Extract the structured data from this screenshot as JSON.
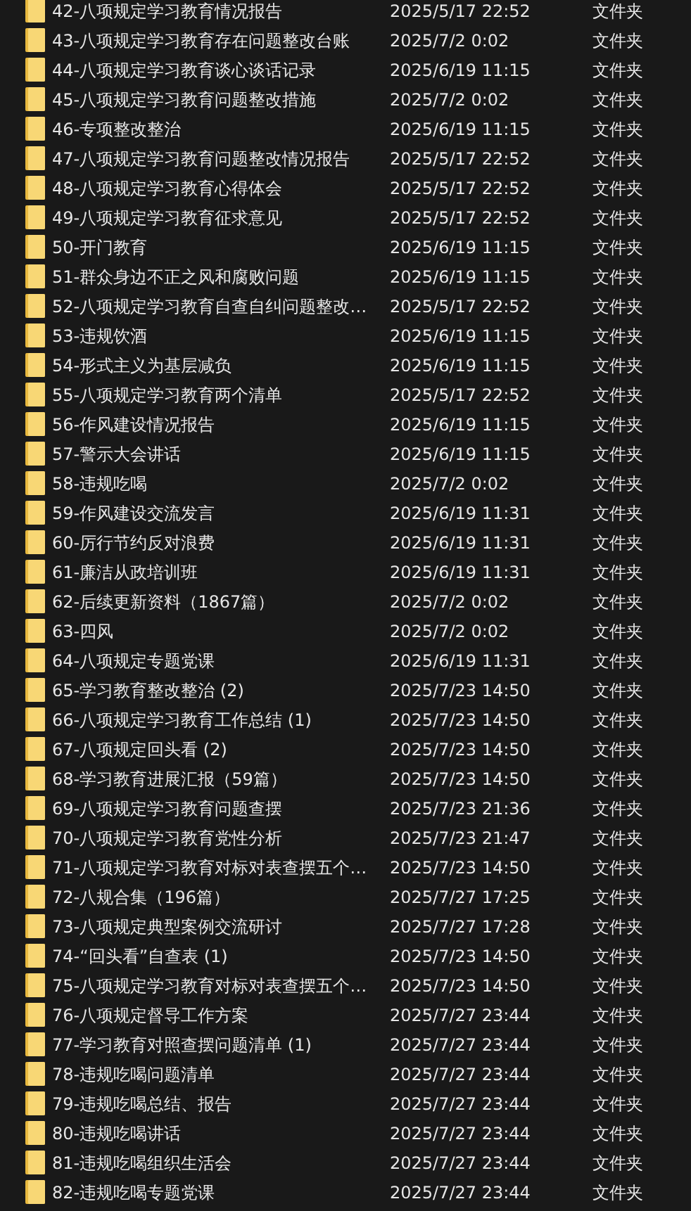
{
  "items": [
    {
      "name": "42-八项规定学习教育情况报告",
      "date": "2025/5/17 22:52",
      "type": "文件夹"
    },
    {
      "name": "43-八项规定学习教育存在问题整改台账",
      "date": "2025/7/2 0:02",
      "type": "文件夹"
    },
    {
      "name": "44-八项规定学习教育谈心谈话记录",
      "date": "2025/6/19 11:15",
      "type": "文件夹"
    },
    {
      "name": "45-八项规定学习教育问题整改措施",
      "date": "2025/7/2 0:02",
      "type": "文件夹"
    },
    {
      "name": "46-专项整改整治",
      "date": "2025/6/19 11:15",
      "type": "文件夹"
    },
    {
      "name": "47-八项规定学习教育问题整改情况报告",
      "date": "2025/5/17 22:52",
      "type": "文件夹"
    },
    {
      "name": "48-八项规定学习教育心得体会",
      "date": "2025/5/17 22:52",
      "type": "文件夹"
    },
    {
      "name": "49-八项规定学习教育征求意见",
      "date": "2025/5/17 22:52",
      "type": "文件夹"
    },
    {
      "name": "50-开门教育",
      "date": "2025/6/19 11:15",
      "type": "文件夹"
    },
    {
      "name": "51-群众身边不正之风和腐败问题",
      "date": "2025/6/19 11:15",
      "type": "文件夹"
    },
    {
      "name": "52-八项规定学习教育自查自纠问题整改…",
      "date": "2025/5/17 22:52",
      "type": "文件夹"
    },
    {
      "name": "53-违规饮酒",
      "date": "2025/6/19 11:15",
      "type": "文件夹"
    },
    {
      "name": "54-形式主义为基层减负",
      "date": "2025/6/19 11:15",
      "type": "文件夹"
    },
    {
      "name": "55-八项规定学习教育两个清单",
      "date": "2025/5/17 22:52",
      "type": "文件夹"
    },
    {
      "name": "56-作风建设情况报告",
      "date": "2025/6/19 11:15",
      "type": "文件夹"
    },
    {
      "name": "57-警示大会讲话",
      "date": "2025/6/19 11:15",
      "type": "文件夹"
    },
    {
      "name": "58-违规吃喝",
      "date": "2025/7/2 0:02",
      "type": "文件夹"
    },
    {
      "name": "59-作风建设交流发言",
      "date": "2025/6/19 11:31",
      "type": "文件夹"
    },
    {
      "name": "60-厉行节约反对浪费",
      "date": "2025/6/19 11:31",
      "type": "文件夹"
    },
    {
      "name": "61-廉洁从政培训班",
      "date": "2025/6/19 11:31",
      "type": "文件夹"
    },
    {
      "name": "62-后续更新资料（1867篇）",
      "date": "2025/7/2 0:02",
      "type": "文件夹"
    },
    {
      "name": "63-四风",
      "date": "2025/7/2 0:02",
      "type": "文件夹"
    },
    {
      "name": "64-八项规定专题党课",
      "date": "2025/6/19 11:31",
      "type": "文件夹"
    },
    {
      "name": "65-学习教育整改整治 (2)",
      "date": "2025/7/23 14:50",
      "type": "文件夹"
    },
    {
      "name": "66-八项规定学习教育工作总结 (1)",
      "date": "2025/7/23 14:50",
      "type": "文件夹"
    },
    {
      "name": "67-八项规定回头看 (2)",
      "date": "2025/7/23 14:50",
      "type": "文件夹"
    },
    {
      "name": "68-学习教育进展汇报（59篇）",
      "date": "2025/7/23 14:50",
      "type": "文件夹"
    },
    {
      "name": "69-八项规定学习教育问题查摆",
      "date": "2025/7/23 21:36",
      "type": "文件夹"
    },
    {
      "name": "70-八项规定学习教育党性分析",
      "date": "2025/7/23 21:47",
      "type": "文件夹"
    },
    {
      "name": "71-八项规定学习教育对标对表查摆五个…",
      "date": "2025/7/23 14:50",
      "type": "文件夹"
    },
    {
      "name": "72-八规合集（196篇）",
      "date": "2025/7/27 17:25",
      "type": "文件夹"
    },
    {
      "name": "73-八项规定典型案例交流研讨",
      "date": "2025/7/27 17:28",
      "type": "文件夹"
    },
    {
      "name": "74-“回头看”自查表 (1)",
      "date": "2025/7/23 14:50",
      "type": "文件夹"
    },
    {
      "name": "75-八项规定学习教育对标对表查摆五个…",
      "date": "2025/7/23 14:50",
      "type": "文件夹"
    },
    {
      "name": "76-八项规定督导工作方案",
      "date": "2025/7/27 23:44",
      "type": "文件夹"
    },
    {
      "name": "77-学习教育对照查摆问题清单 (1)",
      "date": "2025/7/27 23:44",
      "type": "文件夹"
    },
    {
      "name": "78-违规吃喝问题清单",
      "date": "2025/7/27 23:44",
      "type": "文件夹"
    },
    {
      "name": "79-违规吃喝总结、报告",
      "date": "2025/7/27 23:44",
      "type": "文件夹"
    },
    {
      "name": "80-违规吃喝讲话",
      "date": "2025/7/27 23:44",
      "type": "文件夹"
    },
    {
      "name": "81-违规吃喝组织生活会",
      "date": "2025/7/27 23:44",
      "type": "文件夹"
    },
    {
      "name": "82-违规吃喝专题党课",
      "date": "2025/7/27 23:44",
      "type": "文件夹"
    }
  ]
}
